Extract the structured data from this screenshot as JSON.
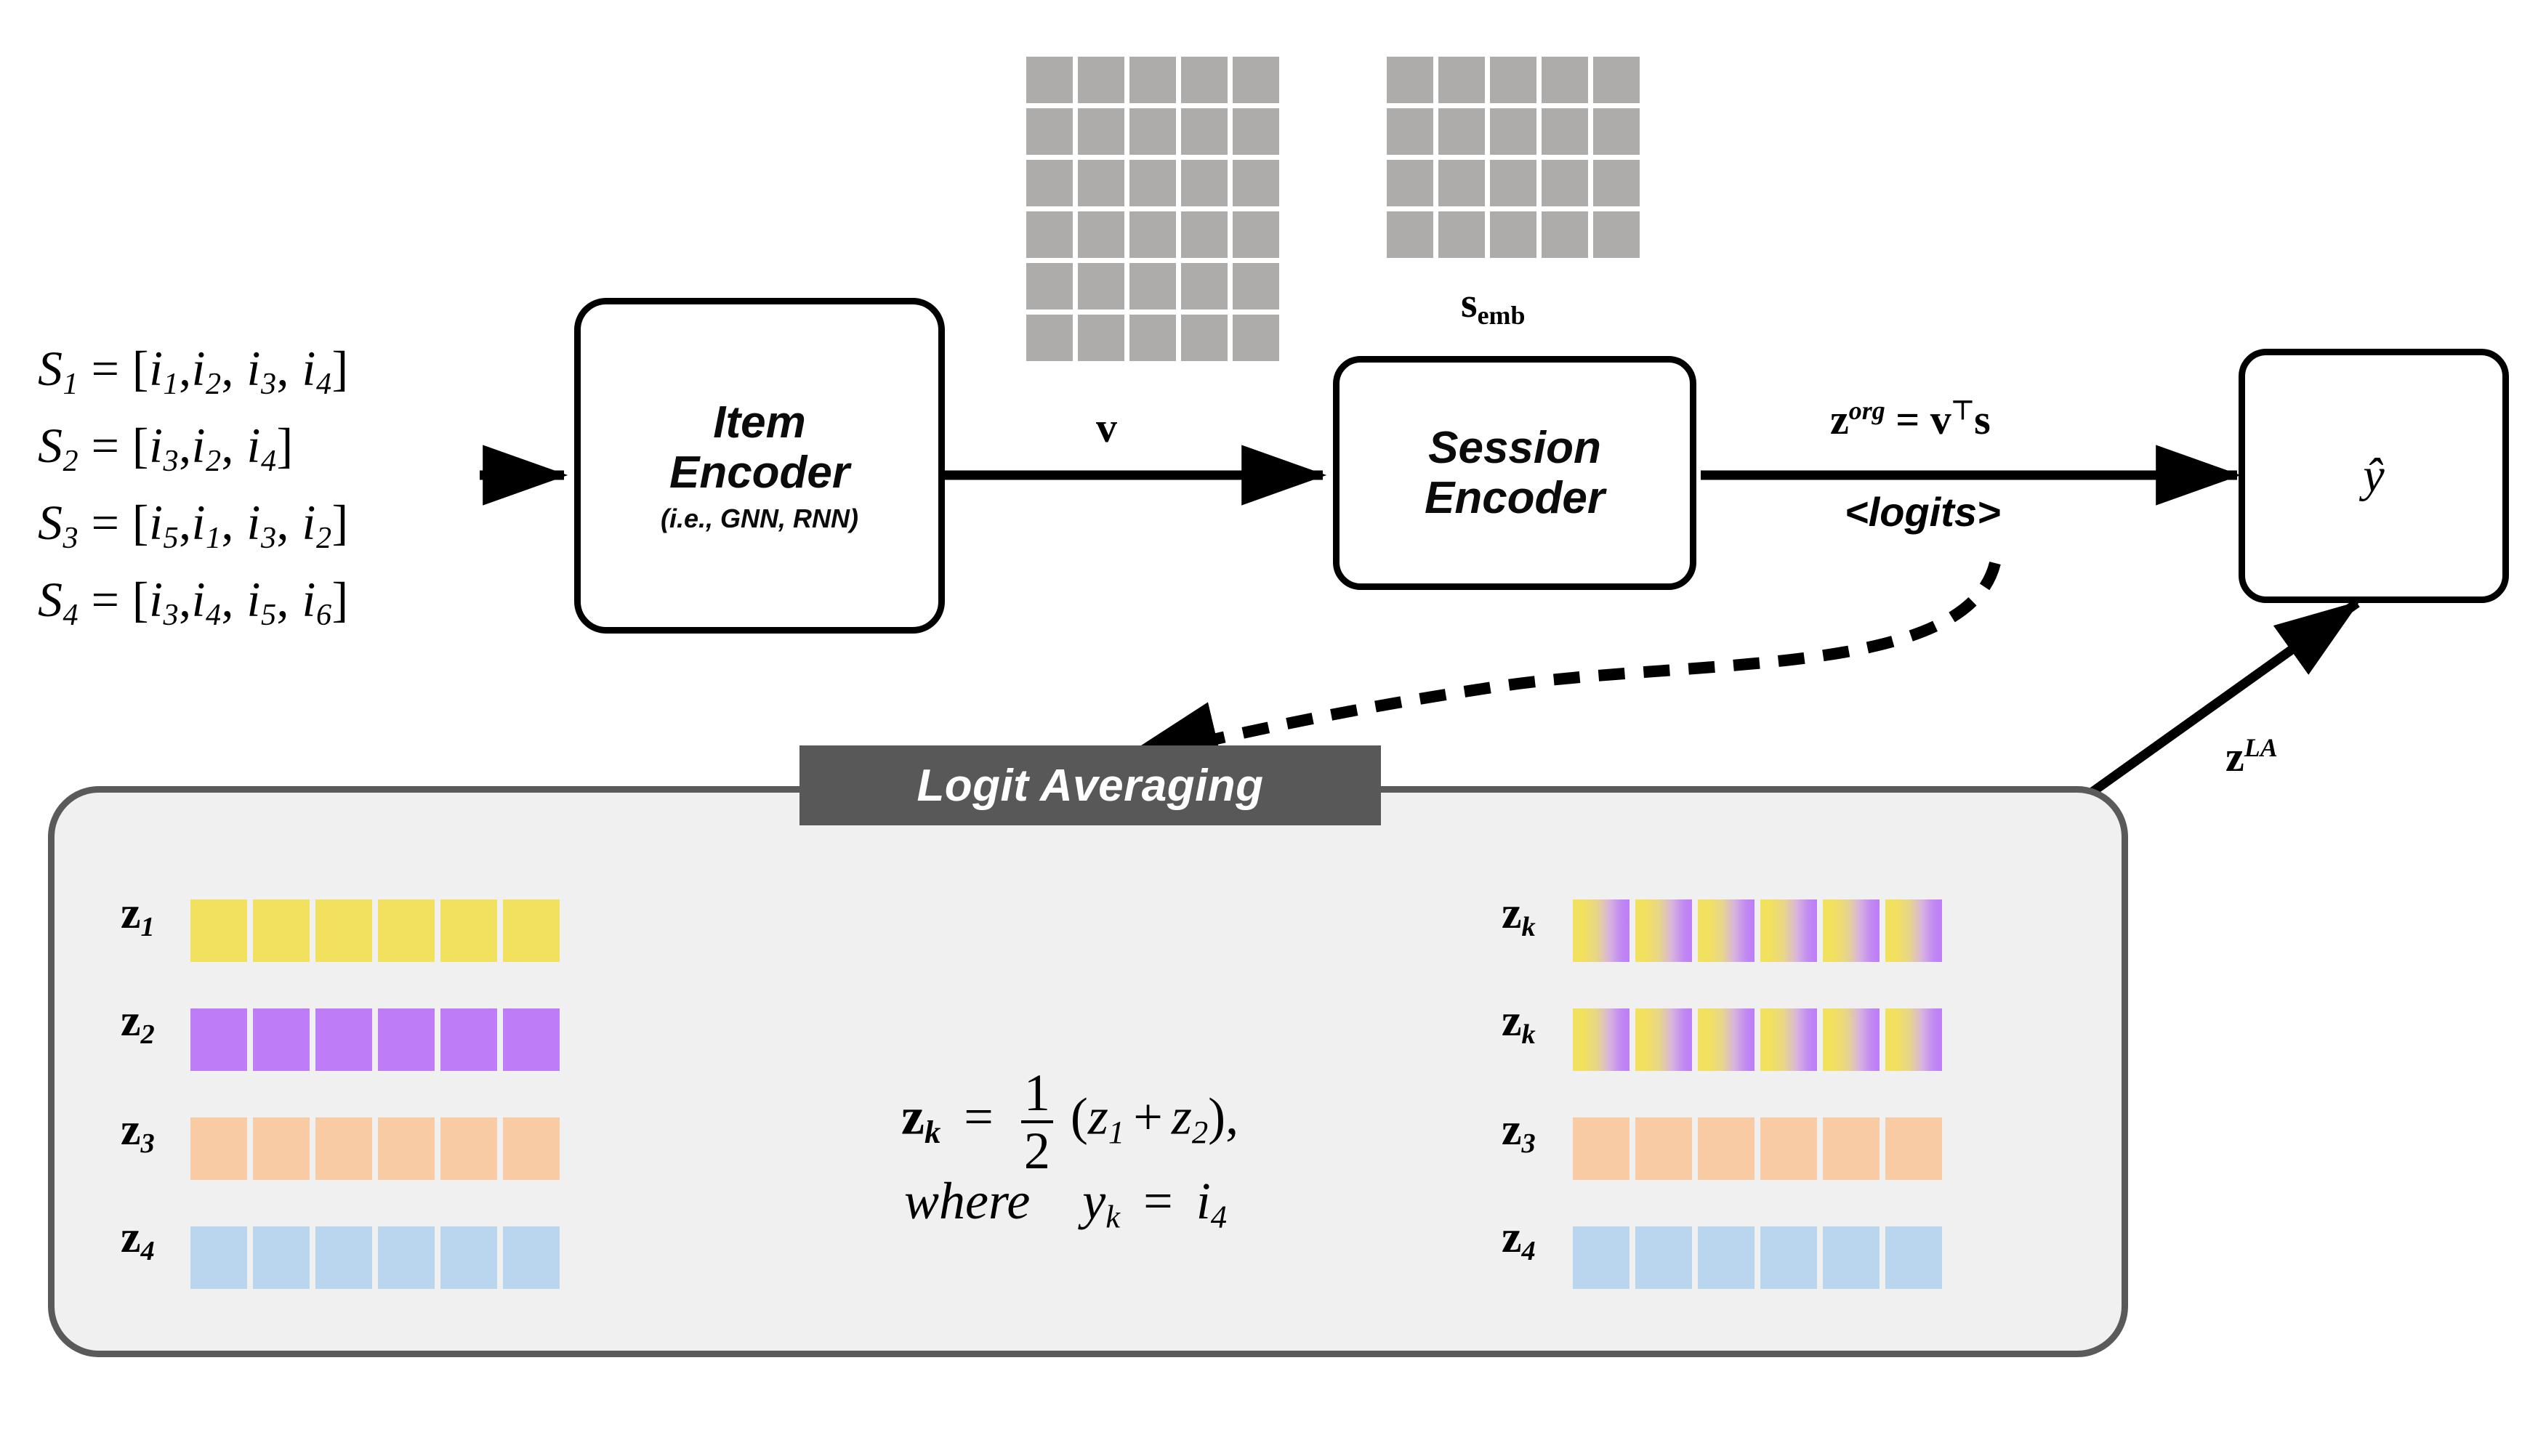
{
  "sessions": {
    "label": "input-sessions",
    "lines": [
      {
        "name": "S",
        "idx": "1",
        "items": [
          {
            "b": "i",
            "s": "1"
          },
          {
            "b": "i",
            "s": "2"
          },
          {
            "b": "i",
            "s": "3"
          },
          {
            "b": "i",
            "s": "4"
          }
        ]
      },
      {
        "name": "S",
        "idx": "2",
        "items": [
          {
            "b": "i",
            "s": "3"
          },
          {
            "b": "i",
            "s": "2"
          },
          {
            "b": "i",
            "s": "4"
          }
        ]
      },
      {
        "name": "S",
        "idx": "3",
        "items": [
          {
            "b": "i",
            "s": "5"
          },
          {
            "b": "i",
            "s": "1"
          },
          {
            "b": "i",
            "s": "3"
          },
          {
            "b": "i",
            "s": "2"
          }
        ]
      },
      {
        "name": "S",
        "idx": "4",
        "items": [
          {
            "b": "i",
            "s": "3"
          },
          {
            "b": "i",
            "s": "4"
          },
          {
            "b": "i",
            "s": "5"
          },
          {
            "b": "i",
            "s": "6"
          }
        ]
      }
    ],
    "plain": [
      "S1 = [i1, i2, i3, i4]",
      "S2 = [i3, i2, i4]",
      "S3 = [i5, i1, i3, i2]",
      "S4 = [i3, i4, i5, i6]"
    ]
  },
  "item_encoder": {
    "title_line1": "Item",
    "title_line2": "Encoder",
    "subtitle": "(i.e., GNN, RNN)"
  },
  "session_encoder": {
    "title_line1": "Session",
    "title_line2": "Encoder"
  },
  "output_box": {
    "label": "ŷ"
  },
  "matrices": {
    "item_matrix": {
      "rows": 6,
      "cols": 5,
      "cell_color": "#aeabab",
      "label": ""
    },
    "session_matrix": {
      "rows": 4,
      "cols": 5,
      "cell_color": "#aeabab",
      "label_base": "s",
      "label_sub": "emb"
    }
  },
  "edge_labels": {
    "v": "v",
    "z_org_base": "z",
    "z_org_sup": "org",
    "z_org_eq": "=",
    "z_org_rhs_v": "v",
    "z_org_rhs_t": "⊤",
    "z_org_rhs_s": "s",
    "logits": "<logits>",
    "z_la_base": "z",
    "z_la_sup": "LA"
  },
  "logit_panel": {
    "banner": "Logit Averaging",
    "panel_fill": "#f0f0f0",
    "panel_border": "#5a5a5a",
    "banner_fill": "#585858",
    "left_rows": [
      {
        "label_base": "z",
        "label_sub": "1",
        "color_name": "yellow",
        "color": "#f2e05f",
        "cells": 6
      },
      {
        "label_base": "z",
        "label_sub": "2",
        "color_name": "purple",
        "color": "#be7df7",
        "cells": 6
      },
      {
        "label_base": "z",
        "label_sub": "3",
        "color_name": "peach",
        "color": "#f9cba5",
        "cells": 6
      },
      {
        "label_base": "z",
        "label_sub": "4",
        "color_name": "blue",
        "color": "#bad6ee",
        "cells": 6
      }
    ],
    "right_rows": [
      {
        "label_base": "z",
        "label_sub": "k",
        "color_name": "gradient",
        "color": "#f2e05f→#be7df7",
        "cells": 6
      },
      {
        "label_base": "z",
        "label_sub": "k",
        "color_name": "gradient",
        "color": "#f2e05f→#be7df7",
        "cells": 6
      },
      {
        "label_base": "z",
        "label_sub": "3",
        "color_name": "peach",
        "color": "#f9cba5",
        "cells": 6
      },
      {
        "label_base": "z",
        "label_sub": "4",
        "color_name": "blue",
        "color": "#bad6ee",
        "cells": 6
      }
    ],
    "formula": {
      "lhs_base": "z",
      "lhs_sub": "k",
      "eq": "=",
      "frac_num": "1",
      "frac_den": "2",
      "rhs": "(z₁ + z₂),",
      "rhs_open": "(",
      "rhs_z1_base": "z",
      "rhs_z1_sub": "1",
      "rhs_plus": "+",
      "rhs_z2_base": "z",
      "rhs_z2_sub": "2",
      "rhs_close": "),",
      "where_word": "where",
      "where_y_base": "y",
      "where_y_sub": "k",
      "where_eq": "=",
      "where_i_base": "i",
      "where_i_sub": "4"
    }
  },
  "colors": {
    "stroke_black": "#000000",
    "gray_cell": "#aeabab",
    "panel_bg": "#f0f0f0",
    "panel_stroke": "#5a5a5a",
    "banner_bg": "#585858",
    "yellow": "#f2e05f",
    "purple": "#be7df7",
    "peach": "#f9cba5",
    "blue": "#bad6ee"
  }
}
